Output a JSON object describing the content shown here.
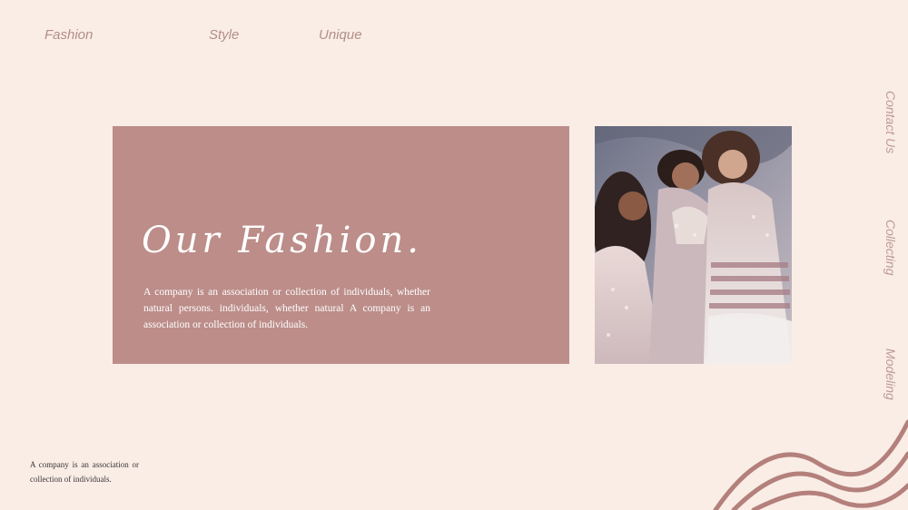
{
  "nav": {
    "items": [
      "Fashion",
      "Style",
      "Unique"
    ]
  },
  "sidebar": {
    "items": [
      "Contact Us",
      "Collecting",
      "Modeling"
    ]
  },
  "card": {
    "title": "Our Fashion.",
    "body": "A company is an association or collection of individuals, whether natural persons. individuals, whether natural A company is an association or collection of individuals."
  },
  "photo": {
    "icon": "fashion-models-photo"
  },
  "footer": {
    "text": "A company is an association or collection of individuals."
  },
  "colors": {
    "background": "#f9ede6",
    "card": "#bc8d89",
    "accent": "#b48e88",
    "wave": "#b4807c"
  }
}
